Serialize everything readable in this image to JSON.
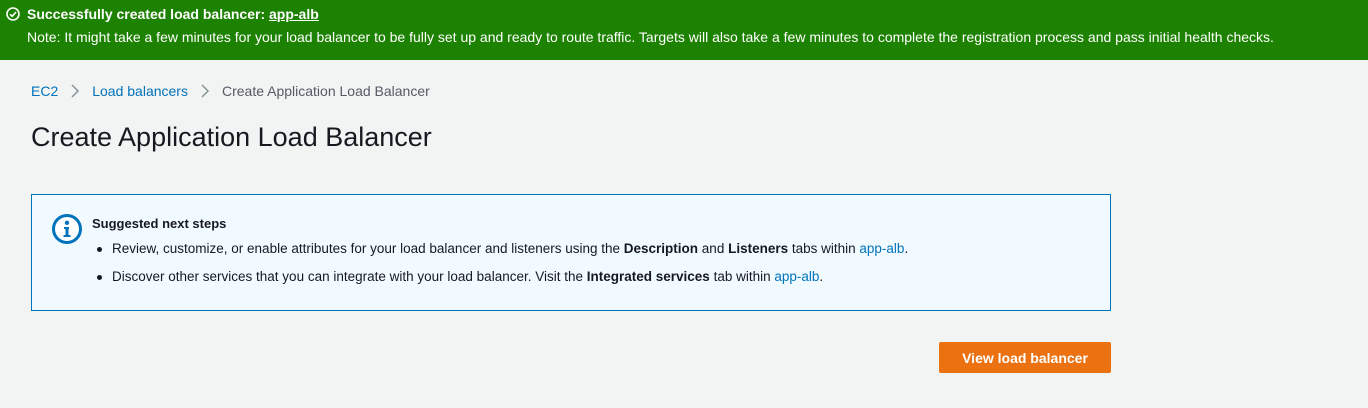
{
  "flash": {
    "title_prefix": "Successfully created load balancer: ",
    "lb_name": "app-alb",
    "note_label": "Note:",
    "note_text": " It might take a few minutes for your load balancer to be fully set up and ready to route traffic. Targets will also take a few minutes to complete the registration process and pass initial health checks.",
    "icon": "check-circle-icon",
    "color": "#1d8102"
  },
  "breadcrumb": {
    "items": [
      "EC2",
      "Load balancers"
    ],
    "current": "Create Application Load Balancer"
  },
  "page_title": "Create Application Load Balancer",
  "info": {
    "icon": "info-icon",
    "title": "Suggested next steps",
    "step1": {
      "pre": "Review, customize, or enable attributes for your load balancer and listeners using the ",
      "b1": "Description",
      "mid": " and ",
      "b2": "Listeners",
      "post": " tabs within ",
      "link": "app-alb",
      "end": "."
    },
    "step2": {
      "pre": "Discover other services that you can integrate with your load balancer. Visit the ",
      "b1": "Integrated services",
      "post": " tab within ",
      "link": "app-alb",
      "end": "."
    }
  },
  "actions": {
    "view_label": "View load balancer"
  },
  "colors": {
    "accent": "#ec7211",
    "link": "#0073bb",
    "info_border": "#0073bb",
    "info_bg": "#f1faff"
  }
}
